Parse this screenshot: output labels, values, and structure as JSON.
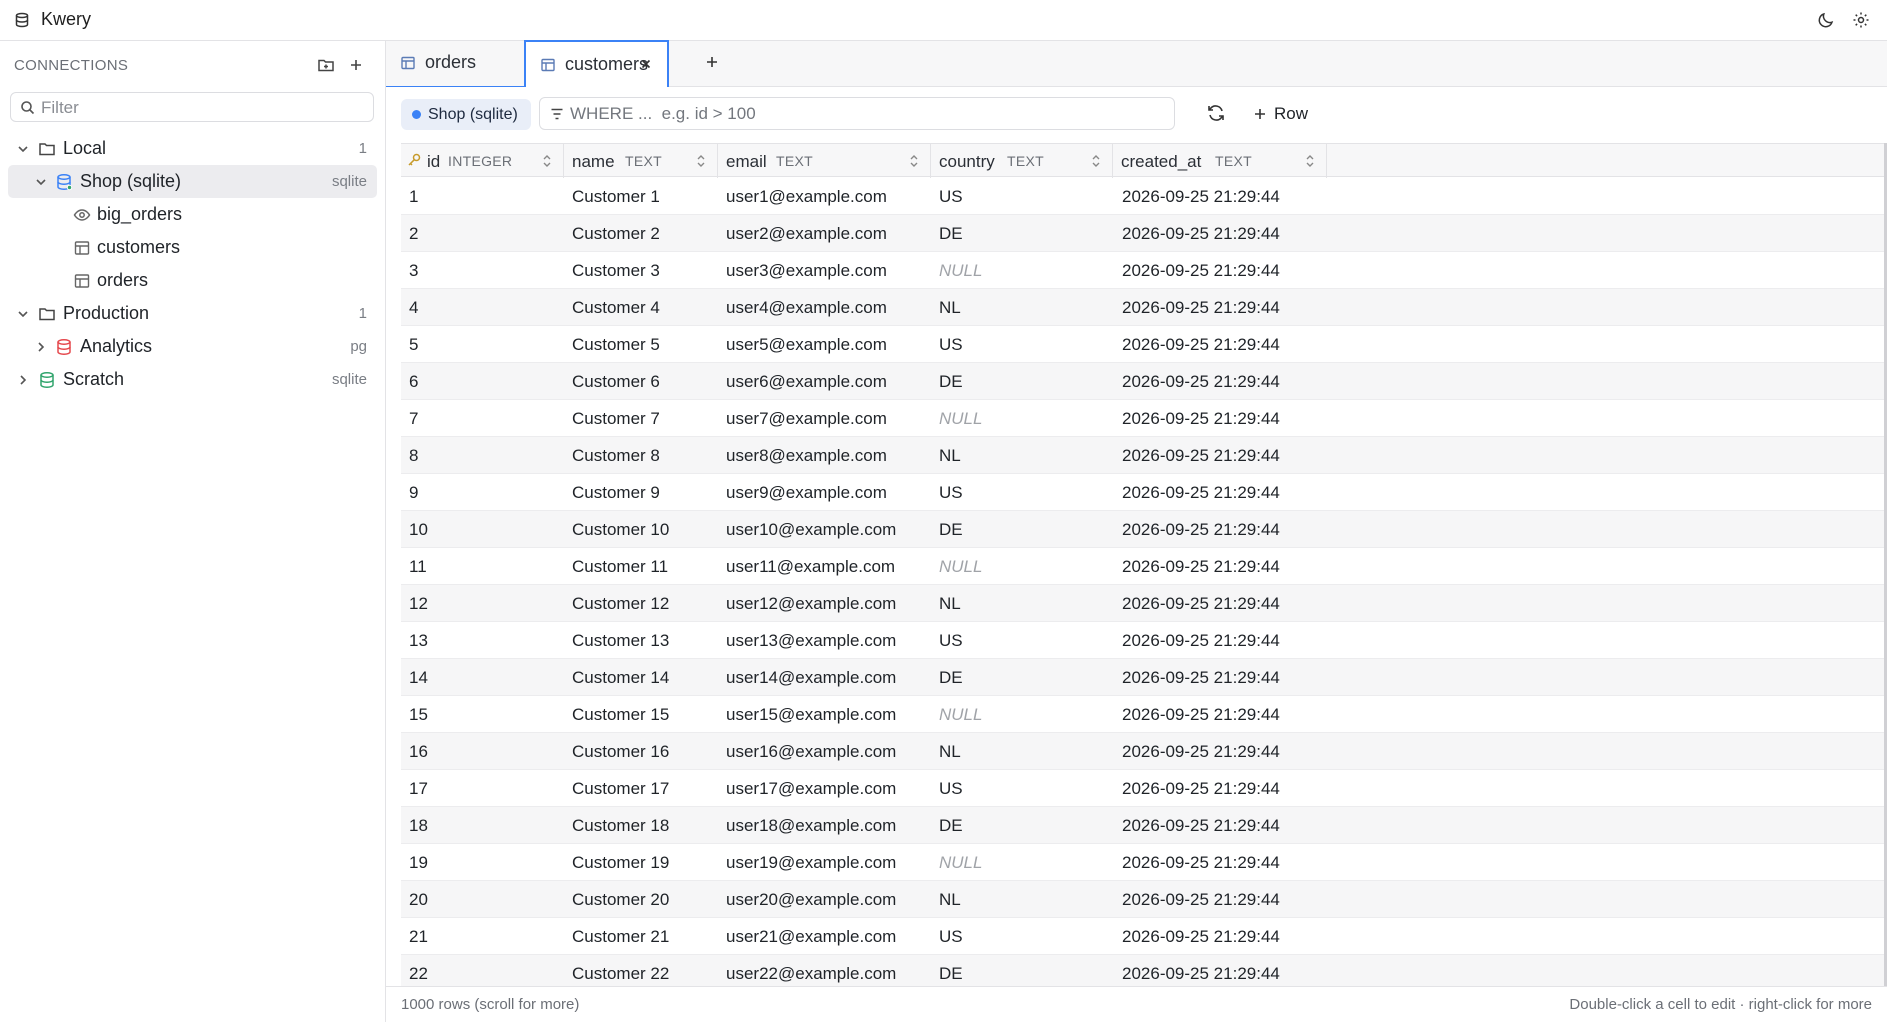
{
  "app": {
    "title": "Kwery"
  },
  "sidebar": {
    "header": "CONNECTIONS",
    "filter_placeholder": "Filter",
    "tree": [
      {
        "label": "Local",
        "meta": "1",
        "kind": "folder",
        "expanded": true
      },
      {
        "label": "Shop (sqlite)",
        "meta": "sqlite",
        "kind": "db",
        "color": "#3b82f6",
        "expanded": true,
        "selected": true
      },
      {
        "label": "big_orders",
        "kind": "view"
      },
      {
        "label": "customers",
        "kind": "table"
      },
      {
        "label": "orders",
        "kind": "table"
      },
      {
        "label": "Production",
        "meta": "1",
        "kind": "folder",
        "expanded": true
      },
      {
        "label": "Analytics",
        "meta": "pg",
        "kind": "db",
        "color": "#e5484d",
        "expanded": false
      },
      {
        "label": "Scratch",
        "meta": "sqlite",
        "kind": "db",
        "color": "#30a46c",
        "expanded": false
      }
    ]
  },
  "tabs": [
    {
      "label": "orders",
      "active": false
    },
    {
      "label": "customers",
      "active": true
    }
  ],
  "toolbar": {
    "connection": "Shop (sqlite)",
    "where_placeholder": "WHERE ...  e.g. id > 100",
    "add_row_label": "Row"
  },
  "columns": [
    {
      "name": "id",
      "type": "INTEGER",
      "primary_key": true
    },
    {
      "name": "name",
      "type": "TEXT"
    },
    {
      "name": "email",
      "type": "TEXT"
    },
    {
      "name": "country",
      "type": "TEXT"
    },
    {
      "name": "created_at",
      "type": "TEXT"
    }
  ],
  "rows": [
    [
      "1",
      "Customer 1",
      "user1@example.com",
      "US",
      "2026-09-25 21:29:44"
    ],
    [
      "2",
      "Customer 2",
      "user2@example.com",
      "DE",
      "2026-09-25 21:29:44"
    ],
    [
      "3",
      "Customer 3",
      "user3@example.com",
      "NULL",
      "2026-09-25 21:29:44"
    ],
    [
      "4",
      "Customer 4",
      "user4@example.com",
      "NL",
      "2026-09-25 21:29:44"
    ],
    [
      "5",
      "Customer 5",
      "user5@example.com",
      "US",
      "2026-09-25 21:29:44"
    ],
    [
      "6",
      "Customer 6",
      "user6@example.com",
      "DE",
      "2026-09-25 21:29:44"
    ],
    [
      "7",
      "Customer 7",
      "user7@example.com",
      "NULL",
      "2026-09-25 21:29:44"
    ],
    [
      "8",
      "Customer 8",
      "user8@example.com",
      "NL",
      "2026-09-25 21:29:44"
    ],
    [
      "9",
      "Customer 9",
      "user9@example.com",
      "US",
      "2026-09-25 21:29:44"
    ],
    [
      "10",
      "Customer 10",
      "user10@example.com",
      "DE",
      "2026-09-25 21:29:44"
    ],
    [
      "11",
      "Customer 11",
      "user11@example.com",
      "NULL",
      "2026-09-25 21:29:44"
    ],
    [
      "12",
      "Customer 12",
      "user12@example.com",
      "NL",
      "2026-09-25 21:29:44"
    ],
    [
      "13",
      "Customer 13",
      "user13@example.com",
      "US",
      "2026-09-25 21:29:44"
    ],
    [
      "14",
      "Customer 14",
      "user14@example.com",
      "DE",
      "2026-09-25 21:29:44"
    ],
    [
      "15",
      "Customer 15",
      "user15@example.com",
      "NULL",
      "2026-09-25 21:29:44"
    ],
    [
      "16",
      "Customer 16",
      "user16@example.com",
      "NL",
      "2026-09-25 21:29:44"
    ],
    [
      "17",
      "Customer 17",
      "user17@example.com",
      "US",
      "2026-09-25 21:29:44"
    ],
    [
      "18",
      "Customer 18",
      "user18@example.com",
      "DE",
      "2026-09-25 21:29:44"
    ],
    [
      "19",
      "Customer 19",
      "user19@example.com",
      "NULL",
      "2026-09-25 21:29:44"
    ],
    [
      "20",
      "Customer 20",
      "user20@example.com",
      "NL",
      "2026-09-25 21:29:44"
    ],
    [
      "21",
      "Customer 21",
      "user21@example.com",
      "US",
      "2026-09-25 21:29:44"
    ],
    [
      "22",
      "Customer 22",
      "user22@example.com",
      "DE",
      "2026-09-25 21:29:44"
    ]
  ],
  "status": {
    "left": "1000 rows (scroll for more)",
    "right": "Double-click a cell to edit · right-click for more"
  }
}
